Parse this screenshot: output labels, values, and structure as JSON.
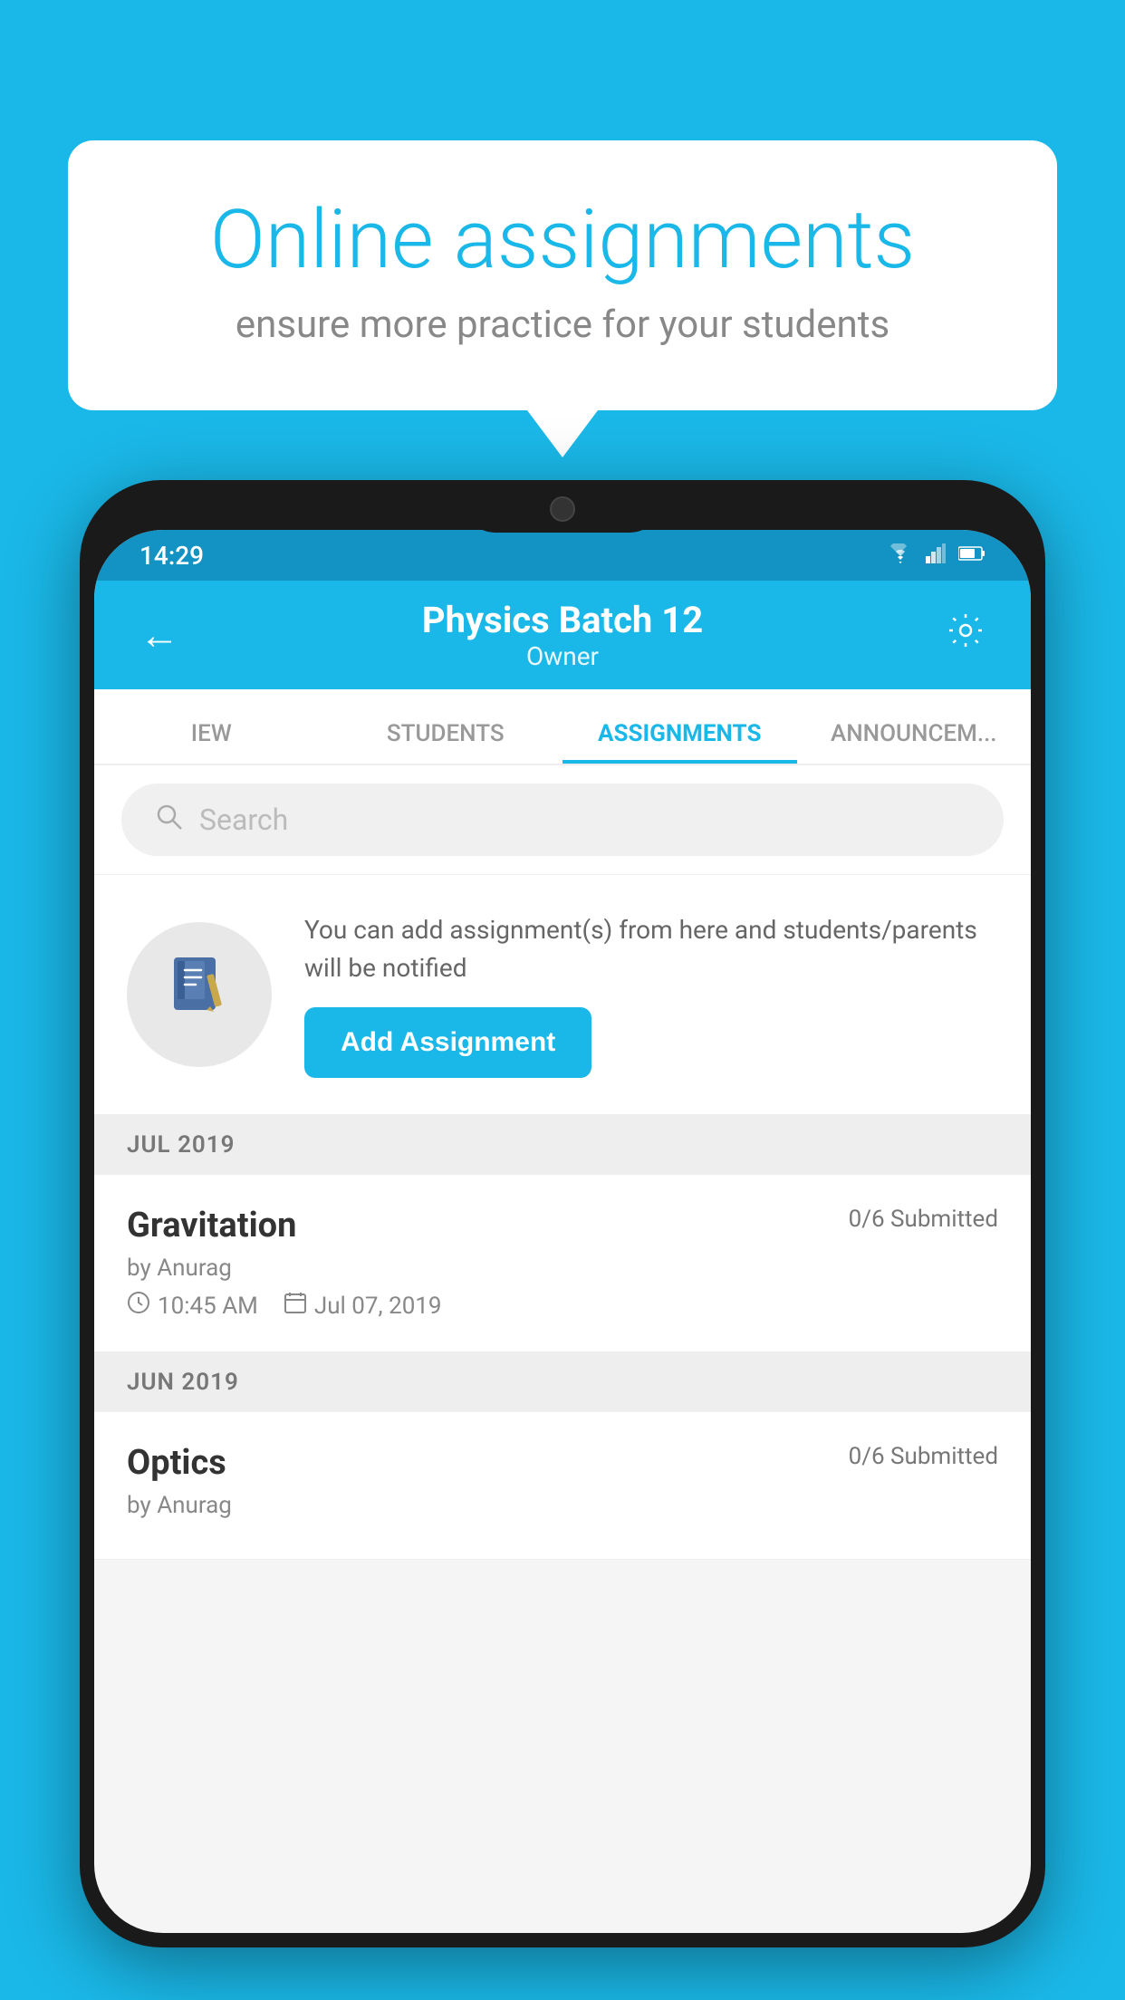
{
  "background_color": "#1ab8e8",
  "bubble": {
    "title": "Online assignments",
    "subtitle": "ensure more practice for your students"
  },
  "status_bar": {
    "time": "14:29",
    "wifi": "▾",
    "signal": "▴",
    "battery": "▮"
  },
  "header": {
    "title": "Physics Batch 12",
    "subtitle": "Owner",
    "back_label": "←",
    "settings_label": "⚙"
  },
  "tabs": [
    {
      "id": "iew",
      "label": "IEW"
    },
    {
      "id": "students",
      "label": "STUDENTS"
    },
    {
      "id": "assignments",
      "label": "ASSIGNMENTS",
      "active": true
    },
    {
      "id": "announcements",
      "label": "ANNOUNCEM..."
    }
  ],
  "search": {
    "placeholder": "Search"
  },
  "add_assignment_section": {
    "description": "You can add assignment(s) from here and students/parents will be notified",
    "button_label": "Add Assignment"
  },
  "sections": [
    {
      "label": "JUL 2019",
      "assignments": [
        {
          "name": "Gravitation",
          "submitted": "0/6 Submitted",
          "by": "by Anurag",
          "time": "10:45 AM",
          "date": "Jul 07, 2019"
        }
      ]
    },
    {
      "label": "JUN 2019",
      "assignments": [
        {
          "name": "Optics",
          "submitted": "0/6 Submitted",
          "by": "by Anurag",
          "time": "",
          "date": ""
        }
      ]
    }
  ]
}
